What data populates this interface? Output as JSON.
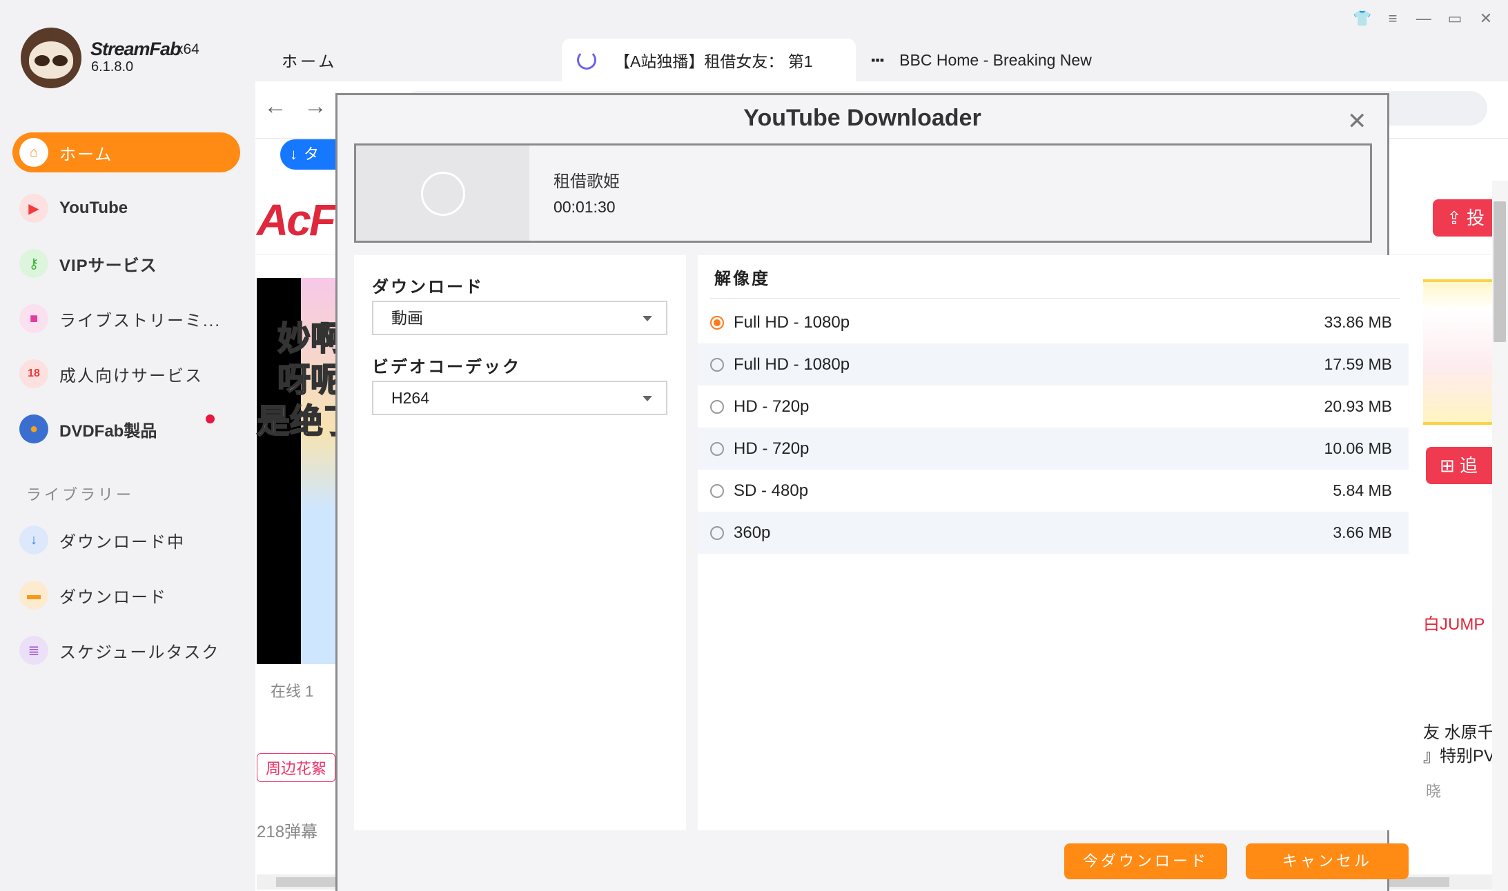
{
  "app": {
    "brand": "StreamFab",
    "arch": "x64",
    "version": "6.1.8.0"
  },
  "sidebar": {
    "items": [
      {
        "label": "ホーム",
        "icon": "home-icon"
      },
      {
        "label": "YouTube",
        "icon": "youtube-icon"
      },
      {
        "label": "VIPサービス",
        "icon": "key-icon"
      },
      {
        "label": "ライブストリーミ...",
        "icon": "camera-icon"
      },
      {
        "label": "成人向けサービス",
        "icon": "adult-icon"
      },
      {
        "label": "DVDFab製品",
        "icon": "dvdfab-icon"
      }
    ],
    "library_heading": "ライブラリー",
    "library": [
      {
        "label": "ダウンロード中",
        "icon": "download-arrow-icon"
      },
      {
        "label": "ダウンロード",
        "icon": "folder-icon"
      },
      {
        "label": "スケジュールタスク",
        "icon": "schedule-icon"
      }
    ]
  },
  "tabs": [
    {
      "label": "ホーム"
    },
    {
      "label": "【A站独播】租借女友： 第1"
    },
    {
      "label": "BBC Home - Breaking New"
    }
  ],
  "background": {
    "logo_text": "AcFu",
    "video_text": [
      "妙啊",
      "呀呢",
      "是绝了"
    ],
    "online": "在线  1",
    "tag": "周边花絮",
    "danmaku": "218弹幕",
    "upload_btn": "投",
    "follow_btn": "追",
    "jump": "白JUMP",
    "right_text_1": "友 水原千",
    "right_text_2": "』特别PV",
    "right_text_3": "晓",
    "blue_btn": "タ"
  },
  "modal": {
    "title": "YouTube Downloader",
    "video": {
      "title": "租借歌姫",
      "duration": "00:01:30"
    },
    "download_label": "ダウンロード",
    "download_value": "動画",
    "codec_label": "ビデオコーデック",
    "codec_value": "H264",
    "resolution_label": "解像度",
    "resolutions": [
      {
        "name": "Full HD - 1080p",
        "size": "33.86 MB",
        "selected": true
      },
      {
        "name": "Full HD - 1080p",
        "size": "17.59 MB",
        "selected": false
      },
      {
        "name": "HD - 720p",
        "size": "20.93 MB",
        "selected": false
      },
      {
        "name": "HD - 720p",
        "size": "10.06 MB",
        "selected": false
      },
      {
        "name": "SD - 480p",
        "size": "5.84 MB",
        "selected": false
      },
      {
        "name": "360p",
        "size": "3.66 MB",
        "selected": false
      }
    ],
    "download_now": "今ダウンロード",
    "cancel": "キャンセル"
  },
  "colors": {
    "accent": "#ff8a14",
    "radio_on": "#ff7a1a",
    "acfun_red": "#e0283c"
  }
}
